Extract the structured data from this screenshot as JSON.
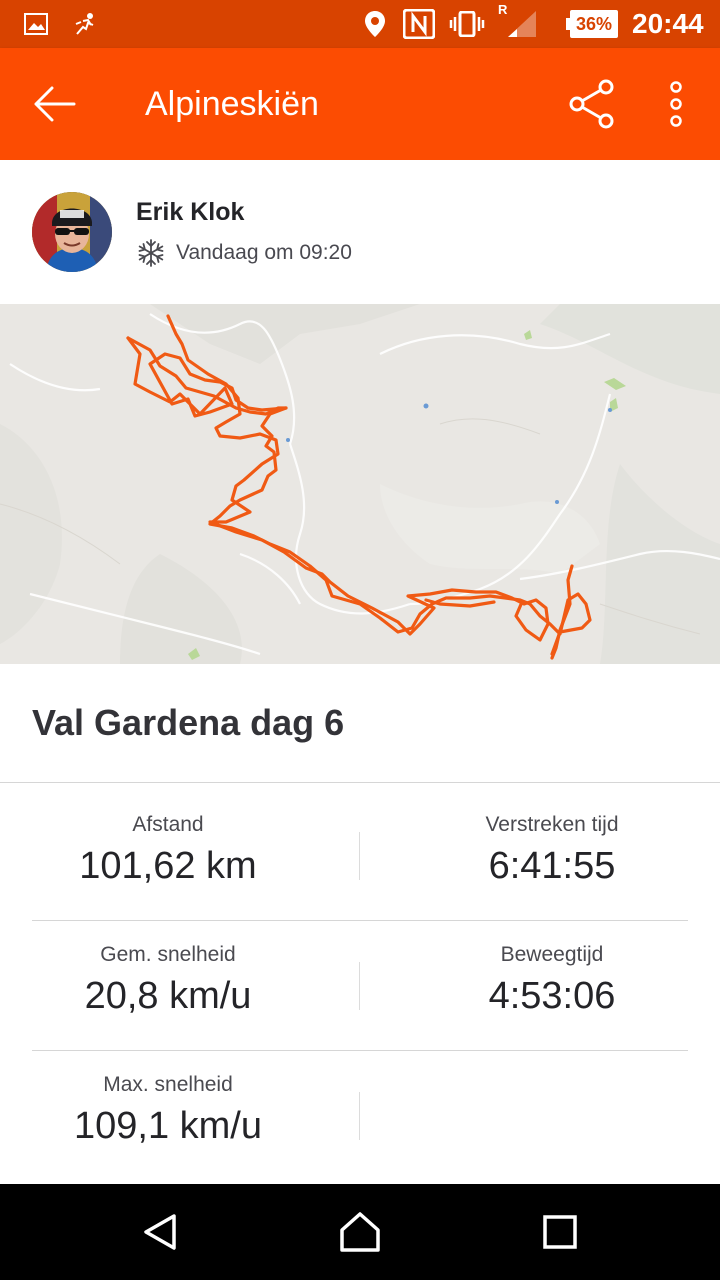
{
  "status_bar": {
    "icons": [
      "gallery-icon",
      "running-notification-icon",
      "location-icon",
      "nfc-icon",
      "vibrate-icon",
      "signal-icon"
    ],
    "roaming": "R",
    "battery": "36%",
    "time": "20:44"
  },
  "app_bar": {
    "title": "Alpineskiën",
    "back_icon": "arrow-back-icon",
    "share_icon": "share-icon",
    "more_icon": "more-vertical-icon"
  },
  "athlete": {
    "name": "Erik Klok",
    "activity_icon": "snowflake-icon",
    "date": "Vandaag om 09:20"
  },
  "activity": {
    "title": "Val Gardena dag 6"
  },
  "stats": [
    {
      "label": "Afstand",
      "value": "101,62 km"
    },
    {
      "label": "Verstreken tijd",
      "value": "6:41:55"
    },
    {
      "label": "Gem. snelheid",
      "value": "20,8 km/u"
    },
    {
      "label": "Beweegtijd",
      "value": "4:53:06"
    },
    {
      "label": "Max. snelheid",
      "value": "109,1 km/u"
    }
  ],
  "nav_bar": {
    "back": "nav-back-icon",
    "home": "nav-home-icon",
    "recents": "nav-recents-icon"
  },
  "colors": {
    "brand": "#fc4c02",
    "status_bar": "#d84300",
    "route": "#f05a14",
    "map_background": "#e9e7e3"
  }
}
